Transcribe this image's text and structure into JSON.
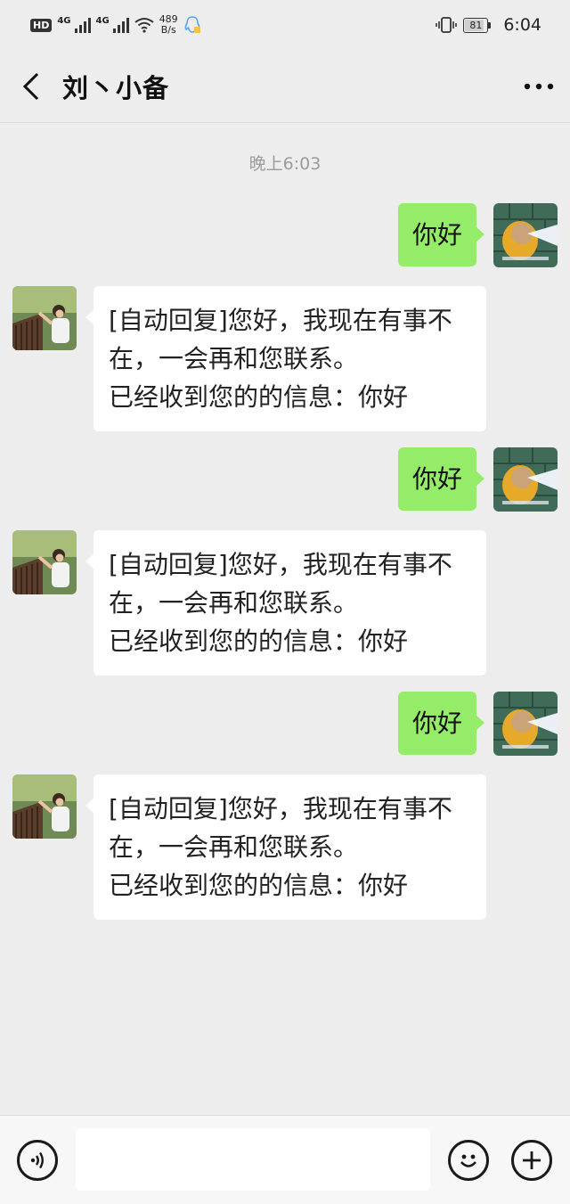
{
  "status_bar": {
    "hd": "HD",
    "net1": "4G",
    "net2": "4G",
    "speed_value": "489",
    "speed_unit": "B/s",
    "battery": "81",
    "time": "6:04"
  },
  "header": {
    "title": "刘丶小备",
    "back_icon": "chevron-left-icon",
    "more_icon": "more-dots-icon"
  },
  "chat": {
    "timestamp": "晚上6:03",
    "messages": [
      {
        "direction": "sent",
        "text": "你好"
      },
      {
        "direction": "received",
        "lines": [
          "[自动回复]您好，我现在有事不",
          "在，一会再和您联系。",
          "已经收到您的的信息：你好"
        ]
      },
      {
        "direction": "sent",
        "text": "你好"
      },
      {
        "direction": "received",
        "lines": [
          "[自动回复]您好，我现在有事不",
          "在，一会再和您联系。",
          "已经收到您的的信息：你好"
        ]
      },
      {
        "direction": "sent",
        "text": "你好"
      },
      {
        "direction": "received",
        "lines": [
          "[自动回复]您好，我现在有事不",
          "在，一会再和您联系。",
          "已经收到您的的信息：你好"
        ]
      }
    ]
  },
  "input_bar": {
    "voice_icon": "voice-icon",
    "emoji_icon": "emoji-icon",
    "plus_icon": "plus-icon",
    "text_value": ""
  },
  "colors": {
    "sent_bubble": "#95ec69",
    "received_bubble": "#ffffff",
    "background": "#ededed"
  }
}
